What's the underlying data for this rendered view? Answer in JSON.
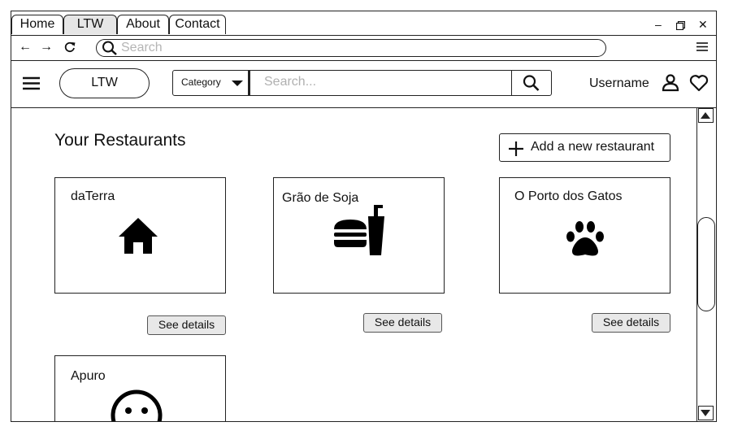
{
  "browser": {
    "tabs": [
      {
        "label": "Home",
        "active": false
      },
      {
        "label": "LTW",
        "active": true
      },
      {
        "label": "About",
        "active": false
      },
      {
        "label": "Contact",
        "active": false
      }
    ],
    "search_placeholder": "Search"
  },
  "header": {
    "logo_label": "LTW",
    "category_label": "Category",
    "search_placeholder": "Search...",
    "username": "Username"
  },
  "main": {
    "title": "Your Restaurants",
    "add_button_label": "Add a new restaurant",
    "details_label": "See details",
    "restaurants": [
      {
        "name": "daTerra",
        "icon": "house-icon"
      },
      {
        "name": "Grão de Soja",
        "icon": "fast-food-icon"
      },
      {
        "name": "O Porto dos Gatos",
        "icon": "paw-icon"
      },
      {
        "name": "Apuro",
        "icon": "smiley-icon"
      }
    ]
  }
}
